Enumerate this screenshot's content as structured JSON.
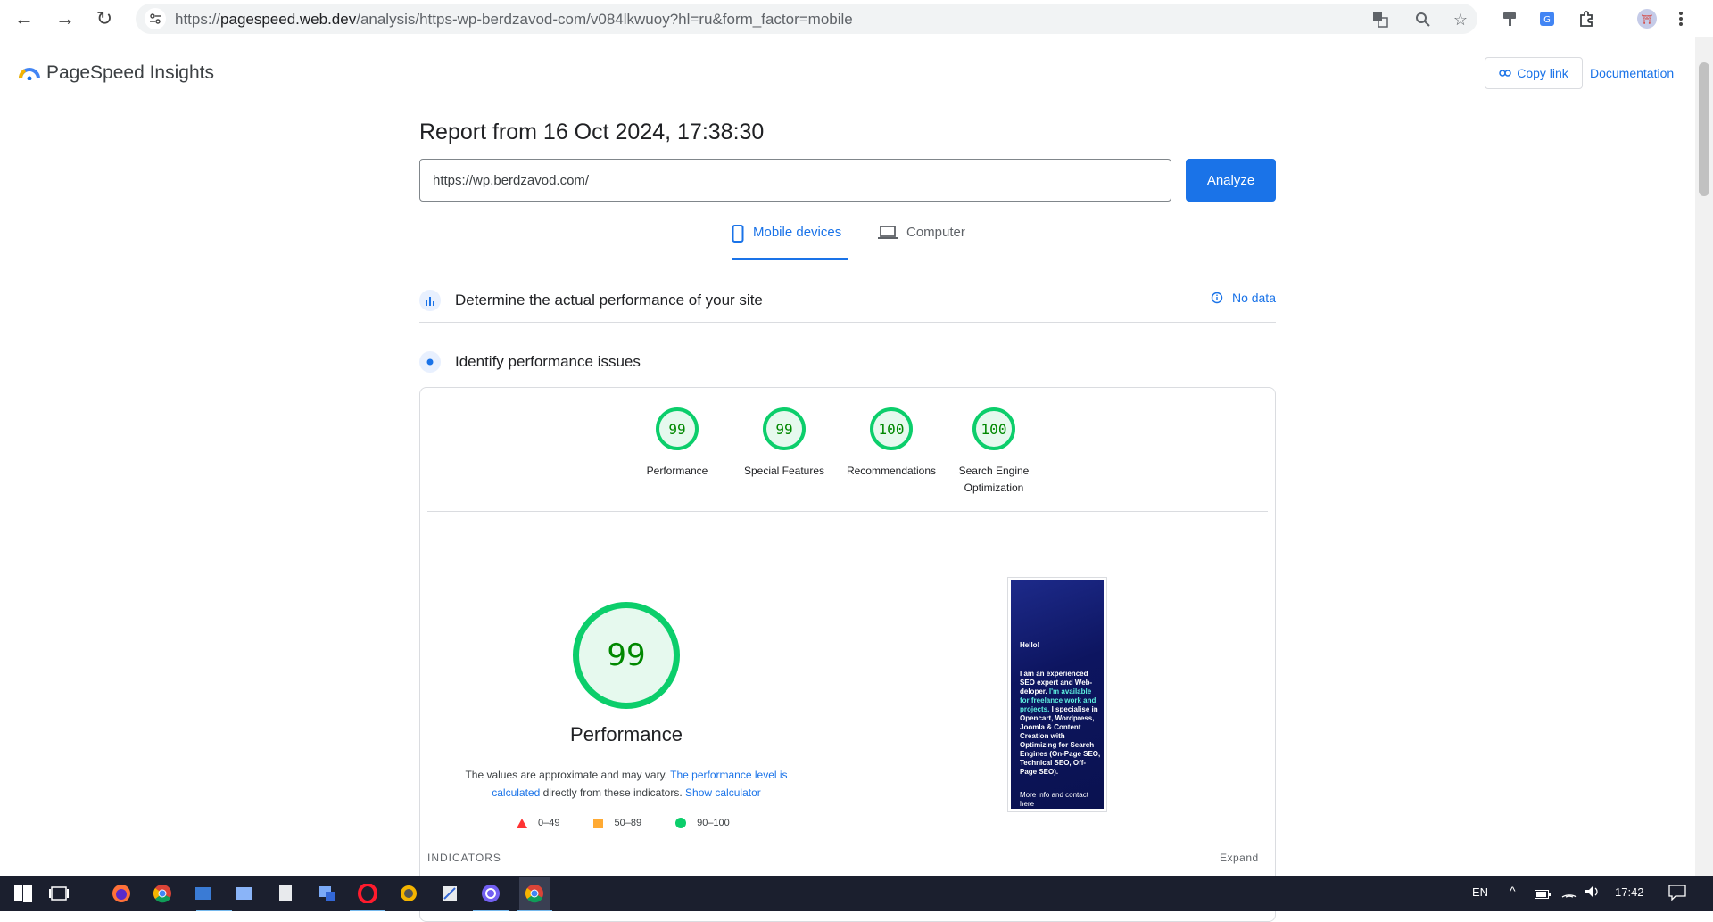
{
  "browser": {
    "url_prefix": "https://",
    "url_host": "pagespeed.web.dev",
    "url_path": "/analysis/https-wp-berdzavod-com/v084lkwuoy?hl=ru&form_factor=mobile"
  },
  "header": {
    "app_title": "PageSpeed Insights",
    "copy_link": "Copy link",
    "documentation": "Documentation"
  },
  "report": {
    "title": "Report from 16 Oct 2024, 17:38:30",
    "url_value": "https://wp.berdzavod.com/",
    "analyze": "Analyze"
  },
  "tabs": [
    {
      "label": "Mobile devices",
      "active": true
    },
    {
      "label": "Computer",
      "active": false
    }
  ],
  "sections": {
    "field": "Determine the actual performance of your site",
    "no_data": "No data",
    "lab": "Identify performance issues"
  },
  "scores": [
    {
      "value": "99",
      "label": "Performance"
    },
    {
      "value": "99",
      "label": "Special Features"
    },
    {
      "value": "100",
      "label": "Recommendations"
    },
    {
      "value": "100",
      "label": "Search Engine Optimization"
    }
  ],
  "performance": {
    "score": "99",
    "title": "Performance",
    "note_1": "The values are approximate and may vary.",
    "note_link_1": "The performance level is calculated",
    "note_2": "directly from these indicators.",
    "note_link_2": "Show calculator"
  },
  "legend": [
    {
      "range": "0–49",
      "color": "#ff3333",
      "shape": "triangle"
    },
    {
      "range": "50–89",
      "color": "#ffaa33",
      "shape": "square"
    },
    {
      "range": "90–100",
      "color": "#0cce6b",
      "shape": "circle"
    }
  ],
  "thumbnail": {
    "hello": "Hello!",
    "text_a": "I am an experienced SEO expert and Web-deloper.",
    "text_hl": "I'm available for freelance work and projects.",
    "text_b": "I specialise in Opencart, Wordpress, Joomla & Content Creation with Optimizing for Search Engines (On-Page SEO, Technical SEO, Off-Page SEO).",
    "more": "More info and contact here"
  },
  "indicators": {
    "label": "INDICATORS",
    "expand": "Expand"
  },
  "taskbar": {
    "lang": "EN",
    "time": "17:42"
  },
  "colors": {
    "accent": "#1a73e8",
    "pass": "#0cce6b"
  }
}
